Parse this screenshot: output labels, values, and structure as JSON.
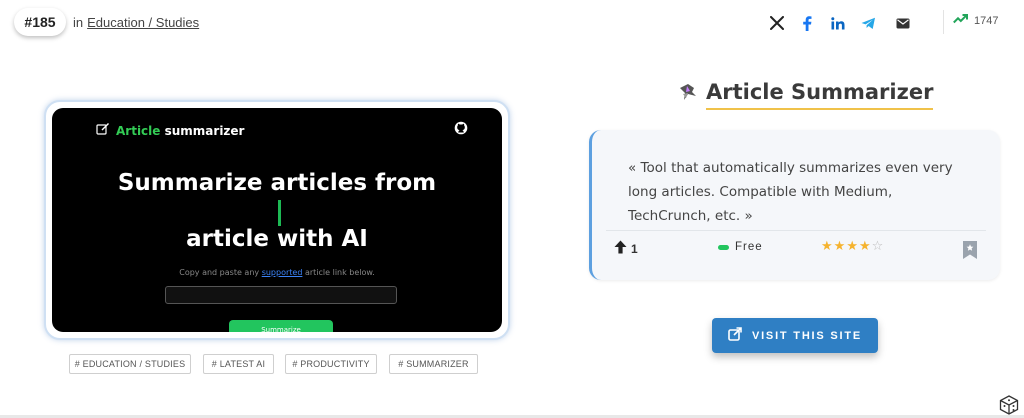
{
  "header": {
    "rank": "#185",
    "category_prefix": "in",
    "category": "Education / Studies",
    "views": "1747"
  },
  "share_icons": [
    "x-icon",
    "facebook-icon",
    "linkedin-icon",
    "telegram-icon",
    "email-icon"
  ],
  "screenshot": {
    "logo_green": "Article",
    "logo_white": "summarizer",
    "headline_1": "Summarize articles from",
    "headline_2": "article with AI",
    "sub_before": "Copy and paste any",
    "sub_link": "supported",
    "sub_after": "article link below.",
    "button": "Summarize"
  },
  "tags": [
    "# EDUCATION / STUDIES",
    "# LATEST AI",
    "# PRODUCTIVITY",
    "# SUMMARIZER"
  ],
  "tool": {
    "name": "Article Summarizer",
    "description": "« Tool that automatically summarizes even very long articles. Compatible with Medium, TechCrunch, etc. »",
    "upvotes": "1",
    "pricing": "Free",
    "rating": 4,
    "rating_max": 5
  },
  "visit_button": "VISIT THIS SITE",
  "colors": {
    "accent": "#2f7fc4",
    "title_underline": "#f0c24a",
    "card_border": "#5da0e0",
    "free_badge": "#22c55e",
    "star": "#f5b32e"
  }
}
